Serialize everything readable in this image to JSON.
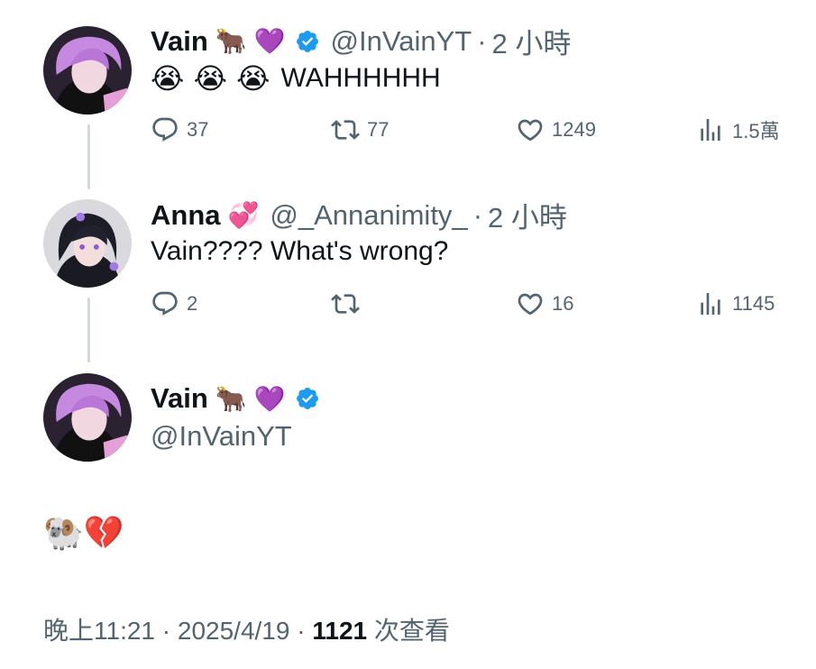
{
  "tweets": [
    {
      "name": "Vain",
      "emoji1": "🐂",
      "emoji2": "💜",
      "handle": "@InVainYT",
      "time": "2 小時",
      "content_emojis": "😭 😭 😭",
      "content_text": "WAHHHHHH",
      "replies": "37",
      "retweets": "77",
      "likes": "1249",
      "views": "1.5萬"
    },
    {
      "name": "Anna",
      "emoji1": "💞",
      "handle": "@_Annanimity_",
      "time": "2 小時",
      "content_text": "Vain???? What's wrong?",
      "replies": "2",
      "retweets": "",
      "likes": "16",
      "views": "1145"
    }
  ],
  "main_tweet": {
    "name": "Vain",
    "emoji1": "🐂",
    "emoji2": "💜",
    "handle": "@InVainYT",
    "content": "🐏💔",
    "footer_time": "晚上11:21",
    "footer_date": "2025/4/19",
    "footer_views": "1121",
    "footer_views_label": "次查看"
  },
  "colors": {
    "text": "#0f1419",
    "secondary": "#536471",
    "verified": "#1d9bf0",
    "thread_line": "#cfd9de"
  },
  "icons": [
    "reply-icon",
    "retweet-icon",
    "like-icon",
    "views-icon",
    "verified-badge-icon"
  ]
}
